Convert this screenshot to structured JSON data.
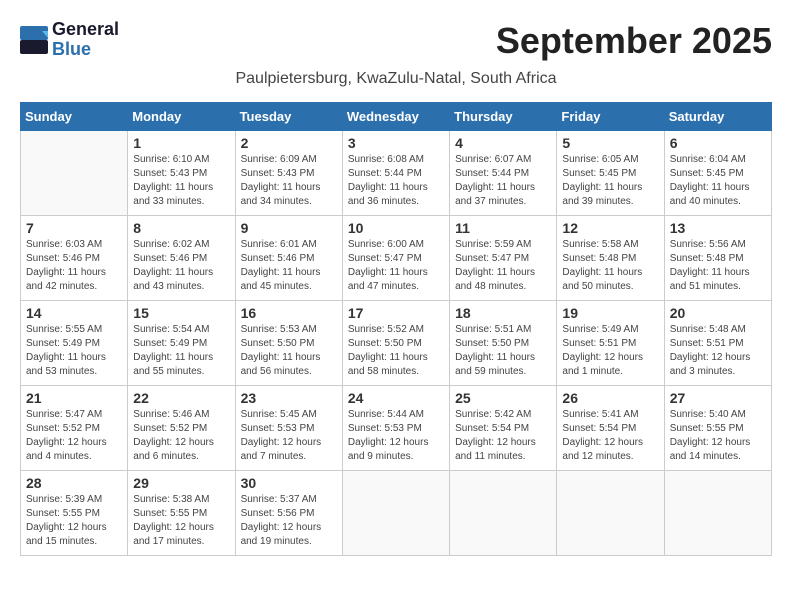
{
  "logo": {
    "line1": "General",
    "line2": "Blue"
  },
  "title": "September 2025",
  "location": "Paulpietersburg, KwaZulu-Natal, South Africa",
  "headers": [
    "Sunday",
    "Monday",
    "Tuesday",
    "Wednesday",
    "Thursday",
    "Friday",
    "Saturday"
  ],
  "weeks": [
    [
      {
        "day": "",
        "info": ""
      },
      {
        "day": "1",
        "info": "Sunrise: 6:10 AM\nSunset: 5:43 PM\nDaylight: 11 hours\nand 33 minutes."
      },
      {
        "day": "2",
        "info": "Sunrise: 6:09 AM\nSunset: 5:43 PM\nDaylight: 11 hours\nand 34 minutes."
      },
      {
        "day": "3",
        "info": "Sunrise: 6:08 AM\nSunset: 5:44 PM\nDaylight: 11 hours\nand 36 minutes."
      },
      {
        "day": "4",
        "info": "Sunrise: 6:07 AM\nSunset: 5:44 PM\nDaylight: 11 hours\nand 37 minutes."
      },
      {
        "day": "5",
        "info": "Sunrise: 6:05 AM\nSunset: 5:45 PM\nDaylight: 11 hours\nand 39 minutes."
      },
      {
        "day": "6",
        "info": "Sunrise: 6:04 AM\nSunset: 5:45 PM\nDaylight: 11 hours\nand 40 minutes."
      }
    ],
    [
      {
        "day": "7",
        "info": "Sunrise: 6:03 AM\nSunset: 5:46 PM\nDaylight: 11 hours\nand 42 minutes."
      },
      {
        "day": "8",
        "info": "Sunrise: 6:02 AM\nSunset: 5:46 PM\nDaylight: 11 hours\nand 43 minutes."
      },
      {
        "day": "9",
        "info": "Sunrise: 6:01 AM\nSunset: 5:46 PM\nDaylight: 11 hours\nand 45 minutes."
      },
      {
        "day": "10",
        "info": "Sunrise: 6:00 AM\nSunset: 5:47 PM\nDaylight: 11 hours\nand 47 minutes."
      },
      {
        "day": "11",
        "info": "Sunrise: 5:59 AM\nSunset: 5:47 PM\nDaylight: 11 hours\nand 48 minutes."
      },
      {
        "day": "12",
        "info": "Sunrise: 5:58 AM\nSunset: 5:48 PM\nDaylight: 11 hours\nand 50 minutes."
      },
      {
        "day": "13",
        "info": "Sunrise: 5:56 AM\nSunset: 5:48 PM\nDaylight: 11 hours\nand 51 minutes."
      }
    ],
    [
      {
        "day": "14",
        "info": "Sunrise: 5:55 AM\nSunset: 5:49 PM\nDaylight: 11 hours\nand 53 minutes."
      },
      {
        "day": "15",
        "info": "Sunrise: 5:54 AM\nSunset: 5:49 PM\nDaylight: 11 hours\nand 55 minutes."
      },
      {
        "day": "16",
        "info": "Sunrise: 5:53 AM\nSunset: 5:50 PM\nDaylight: 11 hours\nand 56 minutes."
      },
      {
        "day": "17",
        "info": "Sunrise: 5:52 AM\nSunset: 5:50 PM\nDaylight: 11 hours\nand 58 minutes."
      },
      {
        "day": "18",
        "info": "Sunrise: 5:51 AM\nSunset: 5:50 PM\nDaylight: 11 hours\nand 59 minutes."
      },
      {
        "day": "19",
        "info": "Sunrise: 5:49 AM\nSunset: 5:51 PM\nDaylight: 12 hours\nand 1 minute."
      },
      {
        "day": "20",
        "info": "Sunrise: 5:48 AM\nSunset: 5:51 PM\nDaylight: 12 hours\nand 3 minutes."
      }
    ],
    [
      {
        "day": "21",
        "info": "Sunrise: 5:47 AM\nSunset: 5:52 PM\nDaylight: 12 hours\nand 4 minutes."
      },
      {
        "day": "22",
        "info": "Sunrise: 5:46 AM\nSunset: 5:52 PM\nDaylight: 12 hours\nand 6 minutes."
      },
      {
        "day": "23",
        "info": "Sunrise: 5:45 AM\nSunset: 5:53 PM\nDaylight: 12 hours\nand 7 minutes."
      },
      {
        "day": "24",
        "info": "Sunrise: 5:44 AM\nSunset: 5:53 PM\nDaylight: 12 hours\nand 9 minutes."
      },
      {
        "day": "25",
        "info": "Sunrise: 5:42 AM\nSunset: 5:54 PM\nDaylight: 12 hours\nand 11 minutes."
      },
      {
        "day": "26",
        "info": "Sunrise: 5:41 AM\nSunset: 5:54 PM\nDaylight: 12 hours\nand 12 minutes."
      },
      {
        "day": "27",
        "info": "Sunrise: 5:40 AM\nSunset: 5:55 PM\nDaylight: 12 hours\nand 14 minutes."
      }
    ],
    [
      {
        "day": "28",
        "info": "Sunrise: 5:39 AM\nSunset: 5:55 PM\nDaylight: 12 hours\nand 15 minutes."
      },
      {
        "day": "29",
        "info": "Sunrise: 5:38 AM\nSunset: 5:55 PM\nDaylight: 12 hours\nand 17 minutes."
      },
      {
        "day": "30",
        "info": "Sunrise: 5:37 AM\nSunset: 5:56 PM\nDaylight: 12 hours\nand 19 minutes."
      },
      {
        "day": "",
        "info": ""
      },
      {
        "day": "",
        "info": ""
      },
      {
        "day": "",
        "info": ""
      },
      {
        "day": "",
        "info": ""
      }
    ]
  ]
}
